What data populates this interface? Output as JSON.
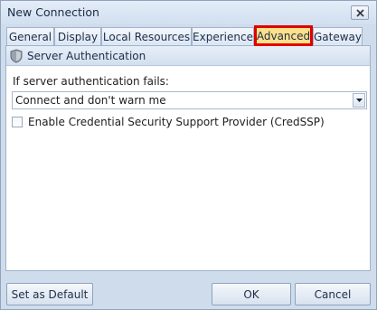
{
  "window": {
    "title": "New Connection"
  },
  "tabs": [
    {
      "label": "General"
    },
    {
      "label": "Display"
    },
    {
      "label": "Local Resources"
    },
    {
      "label": "Experience"
    },
    {
      "label": "Advanced",
      "active": true
    },
    {
      "label": "Gateway"
    }
  ],
  "group": {
    "title": "Server Authentication",
    "icon": "shield-icon"
  },
  "auth": {
    "label": "If server authentication fails:",
    "selected": "Connect and don't warn me"
  },
  "credssp": {
    "label": "Enable Credential Security Support Provider (CredSSP)",
    "checked": false
  },
  "buttons": {
    "set_default": "Set as Default",
    "ok": "OK",
    "cancel": "Cancel"
  },
  "colors": {
    "highlight_border": "#e00000",
    "active_tab_fill": "#fce08c",
    "window_bg": "#cfdcec"
  }
}
